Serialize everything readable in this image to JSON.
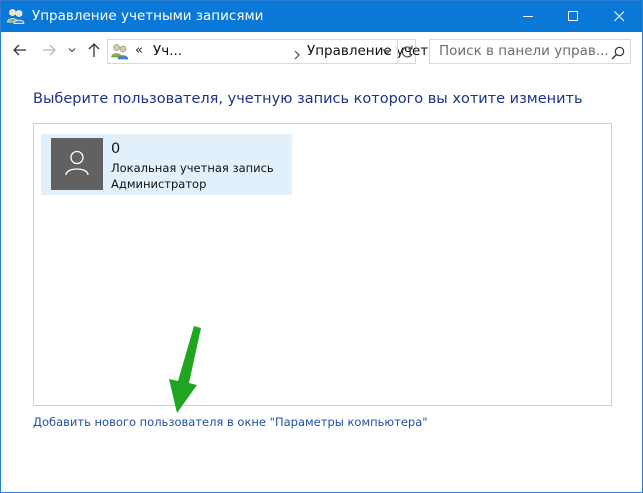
{
  "window": {
    "title": "Управление учетными записями"
  },
  "navigation": {
    "back_icon": "arrow-left-icon",
    "forward_icon": "arrow-right-icon",
    "recent_icon": "chevron-down-icon",
    "up_icon": "arrow-up-icon"
  },
  "address_bar": {
    "separator": "«",
    "crumbs": [
      "Уч...",
      "Управление учет..."
    ]
  },
  "search": {
    "placeholder": "Поиск в панели управ..."
  },
  "main": {
    "heading": "Выберите пользователя, учетную запись которого вы хотите изменить",
    "accounts": [
      {
        "name": "0",
        "type": "Локальная учетная запись",
        "role": "Администратор"
      }
    ],
    "add_user_link": "Добавить нового пользователя в окне \"Параметры компьютера\""
  },
  "colors": {
    "titlebar": "#0a78d7",
    "heading": "#1e3287",
    "link": "#1f4fa8",
    "tile_bg": "#e2f0fb",
    "avatar_bg": "#616161",
    "annotation_arrow": "#1fa51f"
  }
}
